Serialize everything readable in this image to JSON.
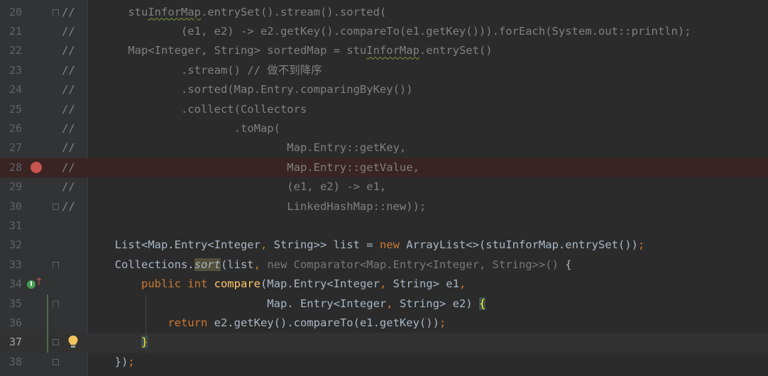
{
  "editor": {
    "lines": [
      {
        "num": "20",
        "segments": [
          [
            "comment",
            "//"
          ],
          [
            "comment",
            "        stu"
          ],
          [
            "comment-warn",
            "InforMap"
          ],
          [
            "comment",
            ".entrySet().stream().sorted("
          ]
        ]
      },
      {
        "num": "21",
        "segments": [
          [
            "comment",
            "//                (e1, e2) -> e2.getKey().compareTo(e1.getKey())).forEach(System.out::println);"
          ]
        ]
      },
      {
        "num": "22",
        "segments": [
          [
            "comment",
            "//        Map<Integer, String> sortedMap = stu"
          ],
          [
            "comment-warn",
            "InforMap"
          ],
          [
            "comment",
            ".entrySet()"
          ]
        ]
      },
      {
        "num": "23",
        "segments": [
          [
            "comment",
            "//                .stream() // 做不到降序"
          ]
        ]
      },
      {
        "num": "24",
        "segments": [
          [
            "comment",
            "//                .sorted(Map.Entry.comparingByKey())"
          ]
        ]
      },
      {
        "num": "25",
        "segments": [
          [
            "comment",
            "//                .collect(Collectors"
          ]
        ]
      },
      {
        "num": "26",
        "segments": [
          [
            "comment",
            "//                        .toMap("
          ]
        ]
      },
      {
        "num": "27",
        "segments": [
          [
            "comment",
            "//                                Map.Entry::getKey,"
          ]
        ]
      },
      {
        "num": "28",
        "segments": [
          [
            "comment",
            "//                                Map.Entry::getValue,"
          ]
        ]
      },
      {
        "num": "29",
        "segments": [
          [
            "comment",
            "//                                (e1, e2) -> e1,"
          ]
        ]
      },
      {
        "num": "30",
        "segments": [
          [
            "comment",
            "//                                LinkedHashMap::new));"
          ]
        ]
      },
      {
        "num": "31",
        "segments": []
      },
      {
        "num": "32",
        "segments": [
          [
            "plain",
            "        List<Map.Entry<Integer"
          ],
          [
            "kw",
            ", "
          ],
          [
            "plain",
            "String>> list = "
          ],
          [
            "kw",
            "new "
          ],
          [
            "plain",
            "ArrayList<>(stuInforMap.entrySet())"
          ],
          [
            "kw",
            ";"
          ]
        ]
      },
      {
        "num": "33",
        "segments": [
          [
            "plain",
            "        Collections."
          ],
          [
            "sort",
            "sort"
          ],
          [
            "plain",
            "(list"
          ],
          [
            "kw",
            ", "
          ],
          [
            "dim",
            "new Comparator<Map.Entry<Integer, String>>() "
          ],
          [
            "plain",
            "{"
          ]
        ]
      },
      {
        "num": "34",
        "segments": [
          [
            "plain",
            "            "
          ],
          [
            "kw",
            "public int "
          ],
          [
            "fn",
            "compare"
          ],
          [
            "plain",
            "(Map.Entry<Integer"
          ],
          [
            "kw",
            ", "
          ],
          [
            "plain",
            "String> e1"
          ],
          [
            "kw",
            ","
          ]
        ]
      },
      {
        "num": "35",
        "segments": [
          [
            "plain",
            "                               Map. Entry<Integer"
          ],
          [
            "kw",
            ", "
          ],
          [
            "plain",
            "String> e2) "
          ],
          [
            "brace",
            "{"
          ]
        ]
      },
      {
        "num": "36",
        "segments": [
          [
            "plain",
            "                "
          ],
          [
            "kw",
            "return "
          ],
          [
            "plain",
            "e2.getKey().compareTo(e1.getKey())"
          ],
          [
            "kw",
            ";"
          ]
        ]
      },
      {
        "num": "37",
        "segments": [
          [
            "plain",
            "            "
          ],
          [
            "brace",
            "}"
          ]
        ]
      },
      {
        "num": "38",
        "segments": [
          [
            "plain",
            "        })"
          ],
          [
            "kw",
            ";"
          ]
        ]
      }
    ],
    "breakpoint_line": "28",
    "current_line": "37",
    "icons": {
      "breakpoint": "breakpoint-icon",
      "implements": "implements-method-icon",
      "intention": "lightbulb-icon",
      "fold": "fold-marker-icon"
    },
    "colors": {
      "background": "#2b2b2b",
      "gutter": "#313335",
      "comment": "#808080",
      "keyword": "#cc7832",
      "method": "#ffc66d",
      "text": "#a9b7c6",
      "breakpoint": "#c75450"
    }
  }
}
